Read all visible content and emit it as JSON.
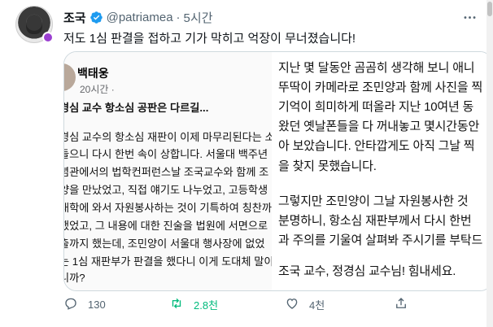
{
  "author": {
    "display_name": "조국",
    "handle": "@patriamea",
    "separator": "·",
    "time": "5시간"
  },
  "tweet": {
    "text": "저도 1심 판결을 접하고 기가 막히고 억장이 무너졌습니다!"
  },
  "media": {
    "left": {
      "author": "백태웅",
      "time": "20시간 ·",
      "lines": [
        "경심 교수 항소심 공판은 다르길...",
        "경심 교수의 항소심 재판이 이제 마무리된다는 소",
        "들으니 다시 한번 속이 상합니다. 서울대 백주년",
        "념관에서의 법학컨퍼런스날 조국교수와 함께 조",
        "양을 만났었고, 직접 얘기도 나누었고, 고등학생",
        "대학에 와서 자원봉사하는 것이 기특하여 칭찬까",
        "했었고, 그 내용에 대한 진술을 법원에 서면으로",
        "출까지 했는데, 조민양이 서울대 행사장에 없었",
        "는 1심 재판부가 판결을 했다니 이게 도대체 말이",
        "니까?"
      ]
    },
    "right": {
      "lines": [
        "지난 몇 달동안 곰곰히 생각해 보니 애니",
        "뚜딱이 카메라로 조민양과 함께 사진을 찍",
        "기억이 희미하게 떠올라 지난 10여년 동",
        "왔던 옛날폰들을 다 꺼내놓고 몇시간동안",
        "아 보았습니다. 안타깝게도 아직 그날 찍",
        "을 찾지 못했습니다.",
        "그렇지만 조민양이 그날 자원봉사한 것 ",
        "분명하니, 항소심 재판부께서 다시 한번",
        "과 주의를 기울여 살펴봐 주시기를 부탁드",
        "조국 교수, 정경심 교수님! 힘내세요."
      ]
    }
  },
  "actions": {
    "reply_count": "130",
    "retweet_count": "2.8천",
    "like_count": "4천",
    "share_count": ""
  },
  "colors": {
    "verified": "#1d9bf0",
    "retweet_active": "#00ba7c",
    "text_secondary": "#536471"
  },
  "icons": [
    "verified-badge-icon",
    "more-icon",
    "reply-icon",
    "retweet-icon",
    "like-icon",
    "share-icon"
  ]
}
